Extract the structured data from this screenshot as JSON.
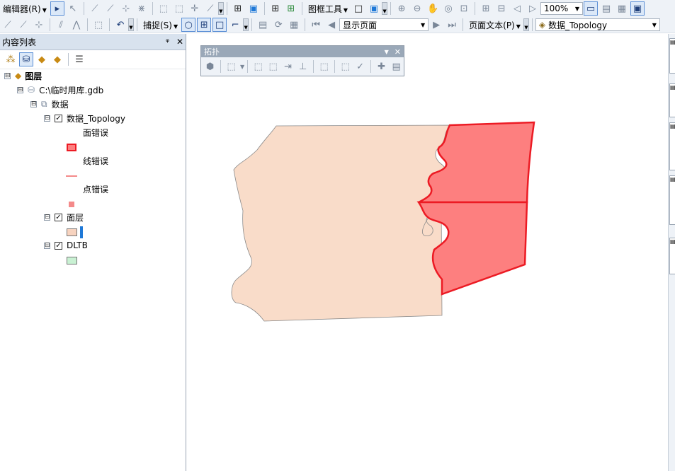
{
  "toolbar1": {
    "editor_label": "编辑器(R)",
    "frame_tools_label": "图框工具",
    "zoom_value": "100%"
  },
  "toolbar2": {
    "snapping_label": "捕捉(S)",
    "page_select_value": "显示页面",
    "page_text_label": "页面文本(P)",
    "topology_combo_value": "数据_Topology"
  },
  "toc": {
    "title": "内容列表",
    "pin_glyph": "ᵠ",
    "close_glyph": "✕",
    "items": [
      {
        "label": "图层",
        "expander": "⊟"
      },
      {
        "label": "C:\\临时用库.gdb",
        "expander": "⊟"
      },
      {
        "label": "数据",
        "expander": "⊟"
      },
      {
        "label": "数据_Topology",
        "expander": "⊟",
        "checked": "✓"
      },
      {
        "label": "面错误"
      },
      {
        "label": "线错误"
      },
      {
        "label": "点错误"
      },
      {
        "label": "面层",
        "expander": "⊟",
        "checked": "✓"
      },
      {
        "label": "DLTB",
        "expander": "⊟",
        "checked": "✓"
      }
    ]
  },
  "topology_toolbar": {
    "title": "拓扑",
    "close_glyph": "✕"
  },
  "colors": {
    "polygon_fill": "#f9dcc9",
    "error_fill": "#fd7f7f",
    "error_stroke": "#ec1b24",
    "dltb_fill": "#c9f1d3",
    "mian_ceng_swatch": "#f7d3bf",
    "accent_blue": "#1e78d7"
  }
}
